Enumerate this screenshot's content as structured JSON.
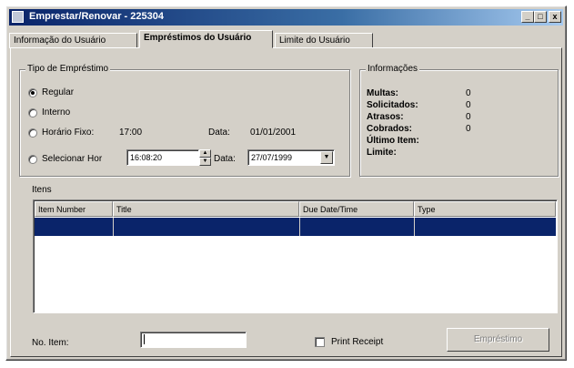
{
  "window": {
    "title": "Emprestar/Renovar - 225304"
  },
  "titlebar_buttons": {
    "min": "_",
    "max": "□",
    "close": "x"
  },
  "tabs": [
    {
      "label": "Informação do Usuário"
    },
    {
      "label": "Empréstimos do Usuário"
    },
    {
      "label": "Limite do Usuário"
    }
  ],
  "tipo": {
    "label": "Tipo de Empréstimo",
    "regular": "Regular",
    "interno": "Interno",
    "horario_fixo": "Horário Fixo:",
    "horario_fixo_value": "17:00",
    "data_label": "Data:",
    "data_fixed_value": "01/01/2001",
    "selecionar": "Selecionar Hor",
    "time_value": "16:08:20",
    "data_combo_value": "27/07/1999"
  },
  "informacoes": {
    "label": "Informações",
    "multas": "Multas:",
    "multas_v": "0",
    "solicitados": "Solicitados:",
    "solicitados_v": "0",
    "atrasos": "Atrasos:",
    "atrasos_v": "0",
    "cobrados": "Cobrados:",
    "cobrados_v": "0",
    "ultimo": "Último Item:",
    "limite": "Limite:"
  },
  "itens": {
    "label": "Itens",
    "columns": [
      "Item Number",
      "Title",
      "Due Date/Time",
      "Type"
    ]
  },
  "bottom": {
    "no_item": "No. Item:",
    "print_receipt": "Print Receipt",
    "emprestimo_button": "Empréstimo"
  }
}
